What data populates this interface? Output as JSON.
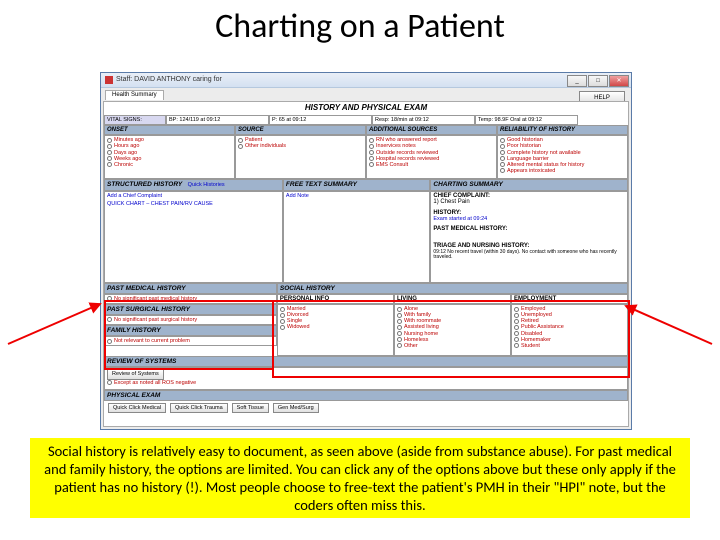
{
  "title": "Charting on a Patient",
  "window": {
    "title_prefix": "Staff: DAVID ANTHONY caring for",
    "tab": "Health Summary",
    "help": "HELP",
    "hp_title": "HISTORY AND PHYSICAL EXAM",
    "vitals_label": "VITAL SIGNS:",
    "vitals": {
      "bp": "BP: 124/119 at 09:12",
      "pulse": "P: 65 at 09:12",
      "resp": "Resp: 18/min at 09:12",
      "temp": "Temp: 98.9F Oral at 09:12"
    },
    "sections": {
      "onset": {
        "title": "ONSET",
        "items": [
          "Minutes ago",
          "Hours ago",
          "Days ago",
          "Weeks ago",
          "Chronic"
        ]
      },
      "source": {
        "title": "SOURCE",
        "items": [
          "Patient",
          "Other individuals"
        ]
      },
      "addl": {
        "title": "ADDITIONAL SOURCES",
        "items": [
          "RN who answered report",
          "Inservices notes",
          "Outside records reviewed",
          "Hospital records reviewed",
          "EMS Consult"
        ]
      },
      "reliab": {
        "title": "RELIABILITY OF HISTORY",
        "items": [
          "Good historian",
          "Poor historian",
          "Complete history not available",
          "Language barrier",
          "Altered mental status for history",
          "Appears intoxicated"
        ]
      }
    },
    "struct_hx": {
      "title": "STRUCTURED HISTORY",
      "quick": "Quick Histories",
      "add": "Add a Chief Complaint",
      "chart": "QUICK CHART – CHEST PAIN/RV CAUSE"
    },
    "free_text": {
      "title": "FREE TEXT SUMMARY",
      "add": "Add Note"
    },
    "chart_sum": {
      "title": "CHARTING SUMMARY",
      "cc_lbl": "CHIEF COMPLAINT:",
      "cc": "1) Chest Pain",
      "hx_lbl": "HISTORY:",
      "hx": "Exam started at 09:24",
      "pmh_lbl": "PAST MEDICAL HISTORY:",
      "tn_lbl": "TRIAGE AND NURSING HISTORY:",
      "tn": "09:12 No recent travel (within 30 days).  No contact with someone who has recently traveled."
    },
    "pmh": {
      "title": "PAST MEDICAL HISTORY",
      "item": "No significant past medical history"
    },
    "psh": {
      "title": "PAST SURGICAL HISTORY",
      "item": "No significant past surgical history"
    },
    "fh": {
      "title": "FAMILY HISTORY",
      "item": "Not relevant to current problem"
    },
    "social": {
      "title": "SOCIAL HISTORY",
      "personal": {
        "title": "PERSONAL INFO",
        "items": [
          "Married",
          "Divorced",
          "Single",
          "Widowed"
        ]
      },
      "living": {
        "title": "LIVING",
        "items": [
          "Alone",
          "With family",
          "With roommate",
          "Assisted living",
          "Nursing home",
          "Homeless",
          "Other"
        ]
      },
      "employ": {
        "title": "EMPLOYMENT",
        "items": [
          "Employed",
          "Unemployed",
          "Retired",
          "Public Assistance",
          "Disabled",
          "Homemaker",
          "Student"
        ]
      }
    },
    "ros": {
      "title": "REVIEW OF SYSTEMS",
      "btn": "Review of Systems",
      "txt": "Except as noted all ROS negative"
    },
    "pe": {
      "title": "PHYSICAL EXAM"
    },
    "bottom_btns": [
      "Quick Click Medical",
      "Quick Click Trauma",
      "Soft Tissue",
      "Gen Med/Surg"
    ]
  },
  "caption": "Social history is relatively easy to document, as seen above (aside from substance abuse). For past medical and family history, the options are limited. You can click any of the options above but these only apply if the patient has no history (!). Most people choose to free-text the patient's PMH in their \"HPI\" note, but the coders often miss this."
}
